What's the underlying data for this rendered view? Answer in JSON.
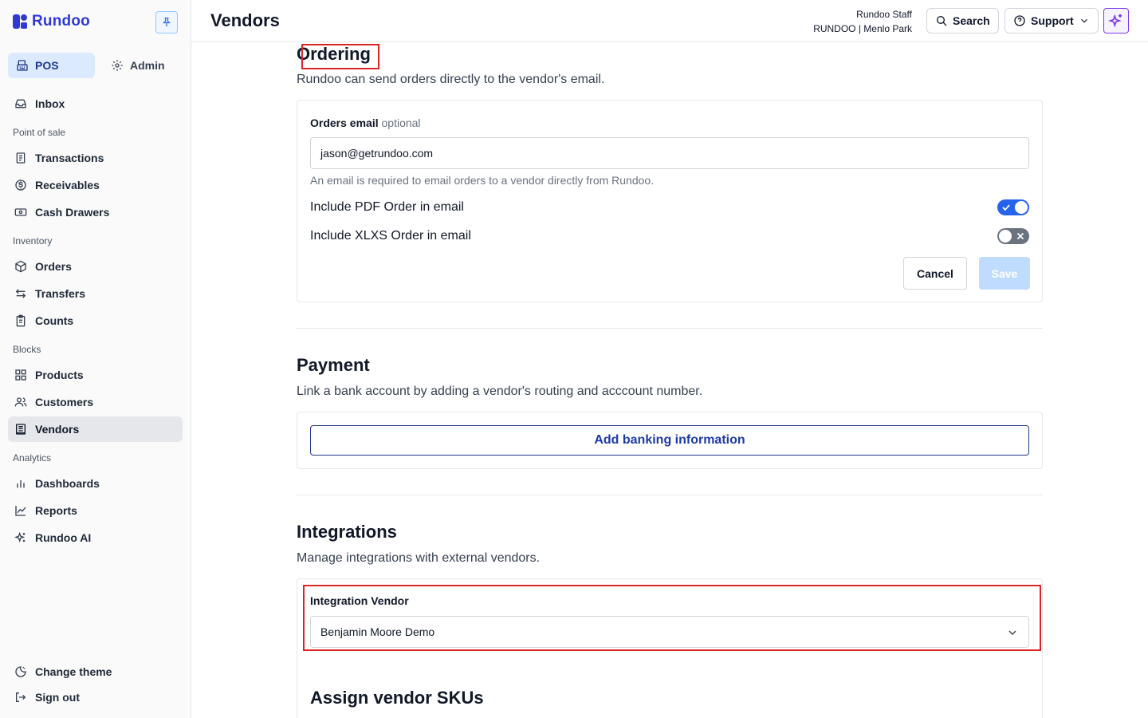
{
  "app": {
    "brand": "Rundoo",
    "colors": {
      "brand": "#2f3ad6",
      "accent": "#2563eb",
      "highlight": "#dc2626"
    }
  },
  "sidebar": {
    "modes": [
      {
        "label": "POS",
        "icon": "register-icon",
        "active": true
      },
      {
        "label": "Admin",
        "icon": "gear-icon",
        "active": false
      }
    ],
    "inbox": {
      "label": "Inbox",
      "icon": "inbox-icon"
    },
    "sections": [
      {
        "title": "Point of sale",
        "items": [
          {
            "label": "Transactions",
            "icon": "receipt-icon"
          },
          {
            "label": "Receivables",
            "icon": "dollar-icon"
          },
          {
            "label": "Cash Drawers",
            "icon": "cash-icon"
          }
        ]
      },
      {
        "title": "Inventory",
        "items": [
          {
            "label": "Orders",
            "icon": "box-icon"
          },
          {
            "label": "Transfers",
            "icon": "arrows-icon"
          },
          {
            "label": "Counts",
            "icon": "clipboard-icon"
          }
        ]
      },
      {
        "title": "Blocks",
        "items": [
          {
            "label": "Products",
            "icon": "grid-icon"
          },
          {
            "label": "Customers",
            "icon": "users-icon"
          },
          {
            "label": "Vendors",
            "icon": "vendor-icon",
            "active": true
          }
        ]
      },
      {
        "title": "Analytics",
        "items": [
          {
            "label": "Dashboards",
            "icon": "bar-chart-icon"
          },
          {
            "label": "Reports",
            "icon": "line-chart-icon"
          },
          {
            "label": "Rundoo AI",
            "icon": "sparkles-icon"
          }
        ]
      }
    ],
    "footer": [
      {
        "label": "Change theme",
        "icon": "theme-icon"
      },
      {
        "label": "Sign out",
        "icon": "sign-out-icon"
      }
    ]
  },
  "header": {
    "title": "Vendors",
    "user_name": "Rundoo Staff",
    "user_location": "RUNDOO | Menlo Park",
    "search_label": "Search",
    "support_label": "Support"
  },
  "ordering": {
    "title": "Ordering",
    "description": "Rundoo can send orders directly to the vendor's email.",
    "email_label": "Orders email",
    "email_optional": "optional",
    "email_value": "jason@getrundoo.com",
    "email_helper": "An email is required to email orders to a vendor directly from Rundoo.",
    "pdf_label": "Include PDF Order in email",
    "pdf_enabled": true,
    "xlxs_label": "Include XLXS Order in email",
    "xlxs_enabled": false,
    "cancel_label": "Cancel",
    "save_label": "Save"
  },
  "payment": {
    "title": "Payment",
    "description": "Link a bank account by adding a vendor's routing and acccount number.",
    "add_banking_label": "Add banking information"
  },
  "integrations": {
    "title": "Integrations",
    "description": "Manage integrations with external vendors.",
    "vendor_label": "Integration Vendor",
    "vendor_value": "Benjamin Moore Demo",
    "assign_title": "Assign vendor SKUs"
  }
}
